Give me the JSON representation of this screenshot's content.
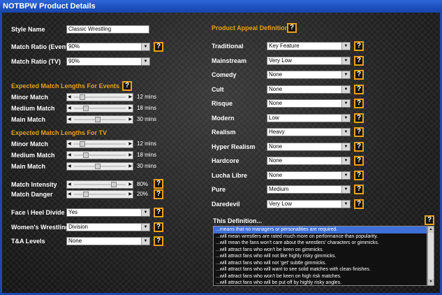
{
  "window": {
    "title": "NOTBPW Product Details"
  },
  "left": {
    "style_name_label": "Style Name",
    "style_name_value": "Classic Wrestling",
    "match_ratio_event_label": "Match Ratio (Event)",
    "match_ratio_event_value": "90%",
    "match_ratio_tv_label": "Match Ratio (TV)",
    "match_ratio_tv_value": "90%",
    "events_section": "Expected Match Lengths For Events",
    "tv_section": "Expected Match Lengths For TV",
    "event_lengths": [
      {
        "label": "Minor Match",
        "value": "12 mins",
        "level": 0.12
      },
      {
        "label": "Medium Match",
        "value": "18 mins",
        "level": 0.2
      },
      {
        "label": "Main Match",
        "value": "30 mins",
        "level": 0.45
      }
    ],
    "tv_lengths": [
      {
        "label": "Minor Match",
        "value": "12 mins",
        "level": 0.12
      },
      {
        "label": "Medium Match",
        "value": "18 mins",
        "level": 0.2
      },
      {
        "label": "Main Match",
        "value": "30 mins",
        "level": 0.45
      }
    ],
    "intensity_label": "Match Intensity",
    "intensity_value": "80%",
    "intensity_level": 0.8,
    "danger_label": "Match Danger",
    "danger_value": "20%",
    "danger_level": 0.2,
    "face_heel_label": "Face \\ Heel Divide",
    "face_heel_value": "Yes",
    "womens_label": "Women's Wrestling",
    "womens_value": "Division",
    "ta_label": "T&A Levels",
    "ta_value": "None"
  },
  "right": {
    "appeal_title": "Product Appeal Definition",
    "appeals": [
      {
        "label": "Traditional",
        "value": "Key Feature"
      },
      {
        "label": "Mainstream",
        "value": "Very Low"
      },
      {
        "label": "Comedy",
        "value": "None"
      },
      {
        "label": "Cult",
        "value": "None"
      },
      {
        "label": "Risque",
        "value": "None"
      },
      {
        "label": "Modern",
        "value": "Low"
      },
      {
        "label": "Realism",
        "value": "Heavy"
      },
      {
        "label": "Hyper Realism",
        "value": "None"
      },
      {
        "label": "Hardcore",
        "value": "None"
      },
      {
        "label": "Lucha Libre",
        "value": "None"
      },
      {
        "label": "Pure",
        "value": "Medium"
      },
      {
        "label": "Daredevil",
        "value": "Very Low"
      }
    ],
    "definition_title": "This Definition...",
    "definition_items": [
      "...means that no managers or personalities are required.",
      "...will mean wrestlers are rated much more on performance than popularity.",
      "...will mean the fans won't care about the wrestlers' characters or gimmicks.",
      "...will attract fans who won't be keen on gimmicks.",
      "...will attract fans who will not like highly risky gimmicks.",
      "...will attract fans who will not 'get' subtle gimmicks.",
      "...will attract fans who will want to see solid matches with clean finishes.",
      "...will attract fans who won't be keen on high risk matches.",
      "...will attract fans who will be put off by highly risky angles."
    ]
  },
  "icons": {
    "help": "?",
    "dropdown": "▼",
    "arrow_left": "◀",
    "arrow_right": "▶",
    "scroll_up": "▲",
    "scroll_down": "▼"
  },
  "colors": {
    "section_heading": "#e8a21a",
    "title_bar": "#1d4fbf",
    "selection": "#3f6fd8"
  }
}
